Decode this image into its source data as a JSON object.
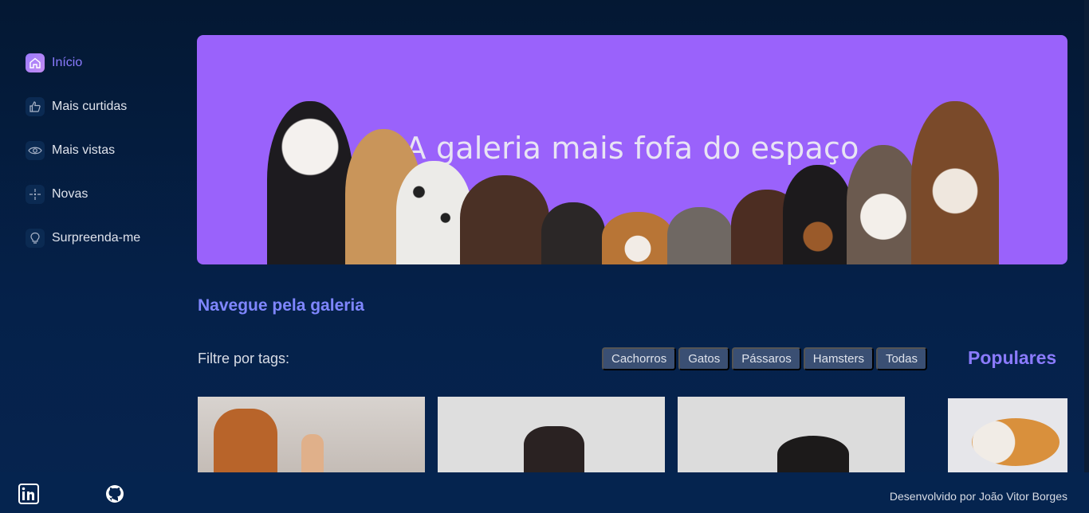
{
  "sidebar": {
    "items": [
      {
        "label": "Início",
        "icon": "home-icon",
        "active": true
      },
      {
        "label": "Mais curtidas",
        "icon": "thumbs-up-icon",
        "active": false
      },
      {
        "label": "Mais vistas",
        "icon": "eye-icon",
        "active": false
      },
      {
        "label": "Novas",
        "icon": "sparkle-icon",
        "active": false
      },
      {
        "label": "Surpreenda-me",
        "icon": "lightbulb-icon",
        "active": false
      }
    ]
  },
  "banner": {
    "title": "A galeria mais fofa do espaço"
  },
  "gallery": {
    "title": "Navegue pela galeria",
    "filter_label": "Filtre por tags:",
    "tags": [
      "Cachorros",
      "Gatos",
      "Pássaros",
      "Hamsters",
      "Todas"
    ]
  },
  "popular": {
    "title": "Populares"
  },
  "footer": {
    "credit": "Desenvolvido por João Vitor Borges",
    "icons": [
      "linkedin-icon",
      "github-icon"
    ]
  },
  "colors": {
    "accent": "#8b7bff",
    "banner_bg": "#9a62fb",
    "tag_bg": "#3a4f73",
    "background": "#041833"
  }
}
